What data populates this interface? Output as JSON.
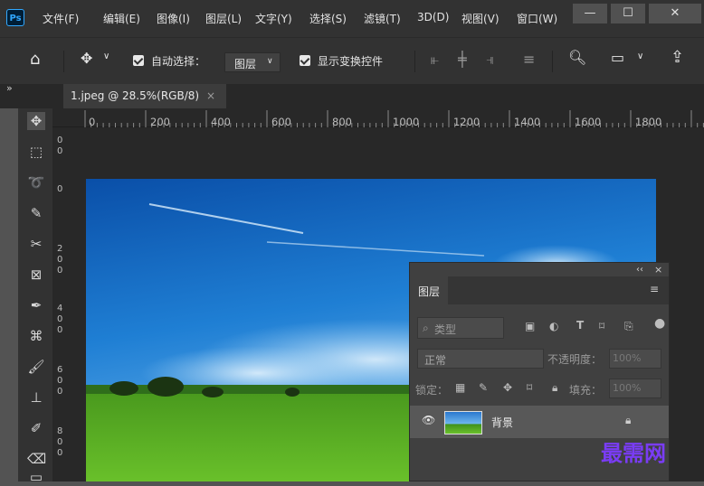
{
  "app": {
    "logo_text": "Ps",
    "menu": [
      "文件(F)",
      "编辑(E)",
      "图像(I)",
      "图层(L)",
      "文字(Y)",
      "选择(S)",
      "滤镜(T)",
      "3D(D)",
      "视图(V)",
      "窗口(W)"
    ],
    "window_controls": {
      "minimize": "—",
      "maximize": "☐",
      "close": "✕"
    }
  },
  "options_bar": {
    "auto_select_label": "自动选择：",
    "auto_select_target": "图层",
    "show_transform_label": "显示变换控件"
  },
  "document": {
    "tab_title": "1.jpeg @ 28.5%(RGB/8)",
    "tab_close": "×"
  },
  "ruler": {
    "horizontal": [
      "0",
      "200",
      "400",
      "600",
      "800",
      "1000",
      "1200",
      "1400",
      "1600",
      "1800"
    ],
    "vertical": [
      [
        "0",
        "0"
      ],
      [
        "0"
      ],
      [
        "2",
        "0",
        "0"
      ],
      [
        "4",
        "0",
        "0"
      ],
      [
        "6",
        "0",
        "0"
      ],
      [
        "8",
        "0",
        "0"
      ]
    ]
  },
  "layers_panel": {
    "collapse_glyph": "‹‹",
    "close_glyph": "×",
    "tab_label": "图层",
    "filter_placeholder": "类型",
    "blend_mode": "正常",
    "opacity_label": "不透明度：",
    "opacity_value": "100%",
    "lock_label": "锁定：",
    "fill_label": "填充：",
    "fill_value": "100%",
    "layers": [
      {
        "name": "背景",
        "visible": true,
        "locked": true
      }
    ]
  },
  "watermark": "最需网",
  "colors": {
    "accent": "#31a8ff",
    "panel": "#404040",
    "watermark": "#7a3cf5"
  }
}
